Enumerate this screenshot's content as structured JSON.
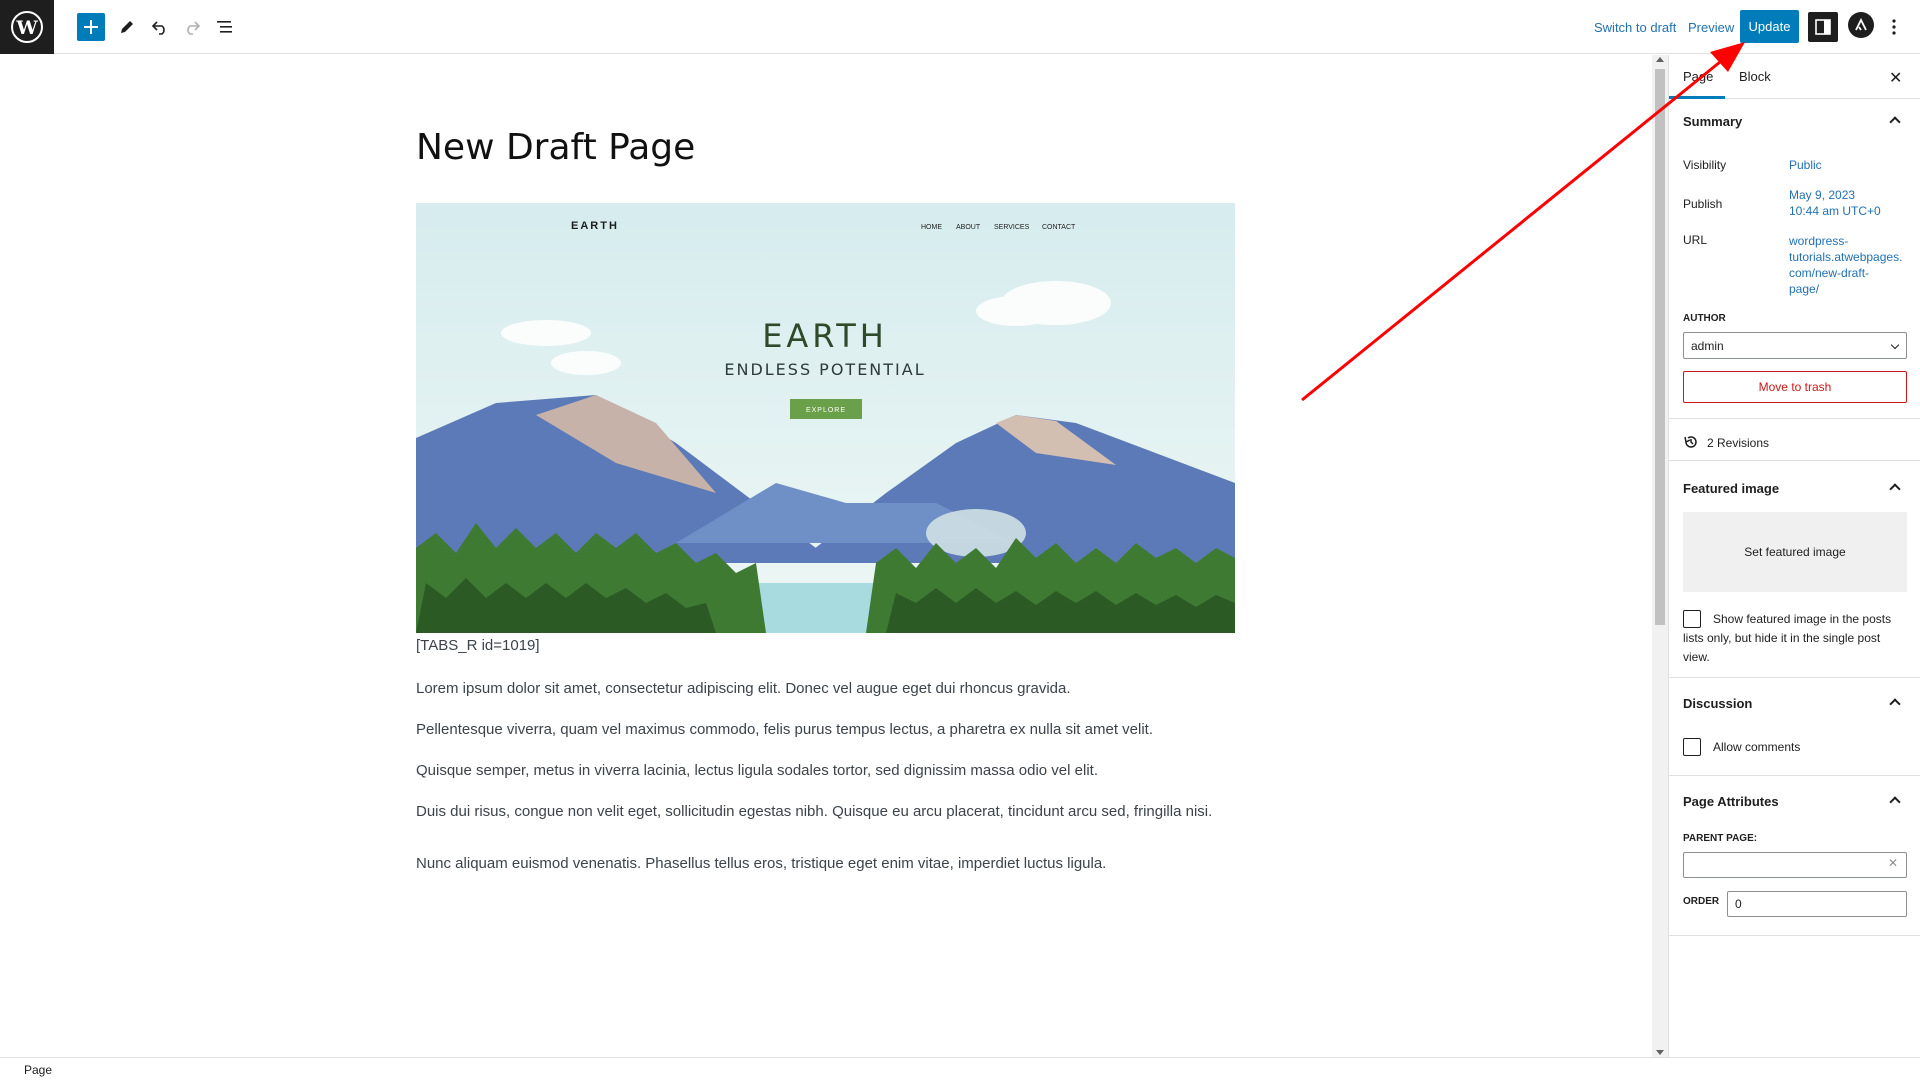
{
  "toolbar": {
    "switch_to_draft": "Switch to draft",
    "preview": "Preview",
    "update": "Update"
  },
  "editor": {
    "title": "New Draft Page",
    "hero": {
      "brand": "EARTH",
      "nav": [
        "HOME",
        "ABOUT",
        "SERVICES",
        "CONTACT"
      ],
      "headline": "EARTH",
      "subheadline": "ENDLESS POTENTIAL",
      "cta": "EXPLORE"
    },
    "shortcode": "[TABS_R id=1019]",
    "paragraphs": [
      "Lorem ipsum dolor sit amet, consectetur adipiscing elit. Donec vel augue eget dui rhoncus gravida.",
      "Pellentesque viverra, quam vel maximus commodo, felis purus tempus lectus, a pharetra ex nulla sit amet velit.",
      "Quisque semper, metus in viverra lacinia, lectus ligula sodales tortor, sed dignissim massa odio vel elit.",
      "Duis dui risus, congue non velit eget, sollicitudin egestas nibh. Quisque eu arcu placerat, tincidunt arcu sed, fringilla nisi.",
      "Nunc aliquam euismod venenatis. Phasellus tellus eros, tristique eget enim vitae, imperdiet luctus ligula."
    ]
  },
  "sidebar": {
    "tab_page": "Page",
    "tab_block": "Block",
    "summary": {
      "heading": "Summary",
      "visibility_label": "Visibility",
      "visibility_value": "Public",
      "publish_label": "Publish",
      "publish_value_line1": "May 9, 2023",
      "publish_value_line2": "10:44 am UTC+0",
      "url_label": "URL",
      "url_value_lines": [
        "wordpress-",
        "tutorials.atwebpages.",
        "com/new-draft-",
        "page/"
      ],
      "author_label": "AUTHOR",
      "author_value": "admin",
      "trash": "Move to trash"
    },
    "revisions": "2 Revisions",
    "featured": {
      "heading": "Featured image",
      "set": "Set featured image",
      "checkbox_lines": [
        "Show featured image in the posts",
        "lists only, but hide it in the single post",
        "view."
      ]
    },
    "discussion": {
      "heading": "Discussion",
      "allow_comments": "Allow comments"
    },
    "attributes": {
      "heading": "Page Attributes",
      "parent_label": "PARENT PAGE:",
      "order_label": "ORDER",
      "order_value": "0"
    }
  },
  "statusbar": {
    "label": "Page"
  },
  "colors": {
    "accent": "#007cba",
    "annotation_arrow": "#ff0000",
    "danger": "#cc1818"
  }
}
